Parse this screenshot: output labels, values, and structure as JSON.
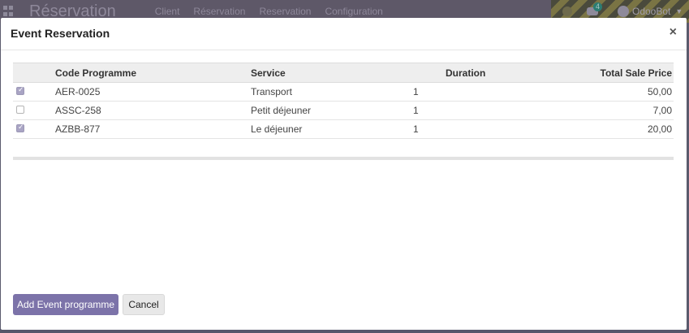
{
  "navbar": {
    "brand": "Réservation",
    "menu": [
      "Client",
      "Réservation",
      "Reservation",
      "Configuration"
    ],
    "chat_count": "4",
    "user": "OdooBot"
  },
  "modal": {
    "title": "Event Reservation",
    "close_glyph": "×",
    "table": {
      "headers": {
        "code": "Code Programme",
        "service": "Service",
        "duration": "Duration",
        "price": "Total Sale Price"
      },
      "rows": [
        {
          "checked": true,
          "code": "AER-0025",
          "service": "Transport",
          "duration": "1",
          "price": "50,00"
        },
        {
          "checked": false,
          "code": "ASSC-258",
          "service": "Petit déjeuner",
          "duration": "1",
          "price": "7,00"
        },
        {
          "checked": true,
          "code": "AZBB-877",
          "service": "Le déjeuner",
          "duration": "1",
          "price": "20,00"
        }
      ]
    },
    "buttons": {
      "primary": "Add Event programme",
      "cancel": "Cancel"
    }
  },
  "colors": {
    "primary": "#7c73a9",
    "navbar": "#5e5868",
    "checkbox_on": "#a9a4c4"
  }
}
